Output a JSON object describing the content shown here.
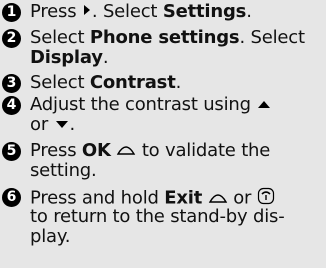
{
  "steps": [
    {
      "number": "1",
      "lines": [
        {
          "pre": "Press ",
          "icon": "right-arrow-icon",
          "mid": ". Select ",
          "bold": "Settings",
          "post": "."
        }
      ]
    },
    {
      "number": "2",
      "lines": [
        {
          "pre": "Select ",
          "bold": "Phone settings",
          "post": ". Select"
        },
        {
          "bold": "Display",
          "post": "."
        }
      ]
    },
    {
      "number": "3",
      "lines": [
        {
          "pre": "Select ",
          "bold": "Contrast",
          "post": "."
        }
      ]
    },
    {
      "number": "4",
      "lines": [
        {
          "pre": "Adjust the contrast using ",
          "icon": "up-triangle-icon"
        },
        {
          "pre": "or ",
          "icon": "down-triangle-icon",
          "post": "."
        }
      ]
    },
    {
      "number": "5",
      "lines": [
        {
          "pre": "Press ",
          "bold": "OK",
          "icon": "softkey-icon",
          "post": " to validate the"
        },
        {
          "pre": "setting."
        }
      ]
    },
    {
      "number": "6",
      "lines": [
        {
          "pre": "Press and hold ",
          "bold": "Exit",
          "icon": "softkey-icon",
          "post": " or ",
          "icon2": "end-call-key-icon"
        },
        {
          "pre": "to return to the stand-by dis-"
        },
        {
          "pre": "play."
        }
      ]
    }
  ]
}
